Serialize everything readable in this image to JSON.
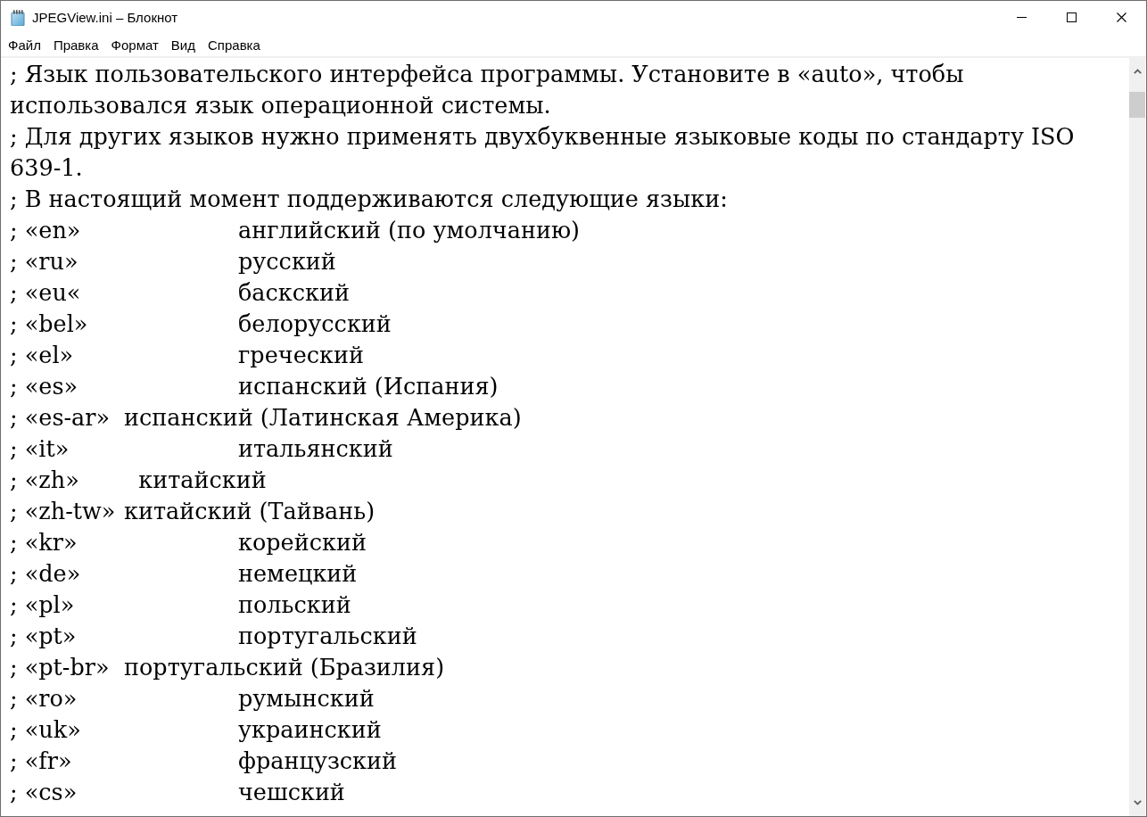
{
  "window": {
    "title": "JPEGView.ini – Блокнот"
  },
  "menu": [
    "Файл",
    "Правка",
    "Формат",
    "Вид",
    "Справка"
  ],
  "editor": {
    "lines": [
      "; Язык пользовательского интерфейса программы. Установите в «auto», чтобы",
      "использовался язык операционной системы.",
      "; Для других языков нужно применять двухбуквенные языковые коды по стандарту ISO",
      "639-1.",
      "; В настоящий момент поддерживаются следующие языки:",
      "; «en»\t\tанглийский (по умолчанию)",
      "; «ru»\t\tрусский",
      "; «eu«\t\tбаскский",
      "; «bel»\t\tбелорусский",
      "; «el»\t\tгреческий",
      "; «es»\t\tиспанский (Испания)",
      "; «es-ar»\tиспанский (Латинская Америка)",
      "; «it»\t\tитальянский",
      "; «zh»\t  китайский",
      "; «zh-tw»\tкитайский (Тайвань)",
      "; «kr»\t\tкорейский",
      "; «de»\t\tнемецкий",
      "; «pl»\t\tпольский",
      "; «pt»\t\tпортугальский",
      "; «pt-br»\tпортугальский (Бразилия)",
      "; «ro»\t\tрумынский",
      "; «uk»\t\tукраинский",
      "; «fr»\t\tфранцузский",
      "; «cs»\t\tчешский"
    ]
  }
}
